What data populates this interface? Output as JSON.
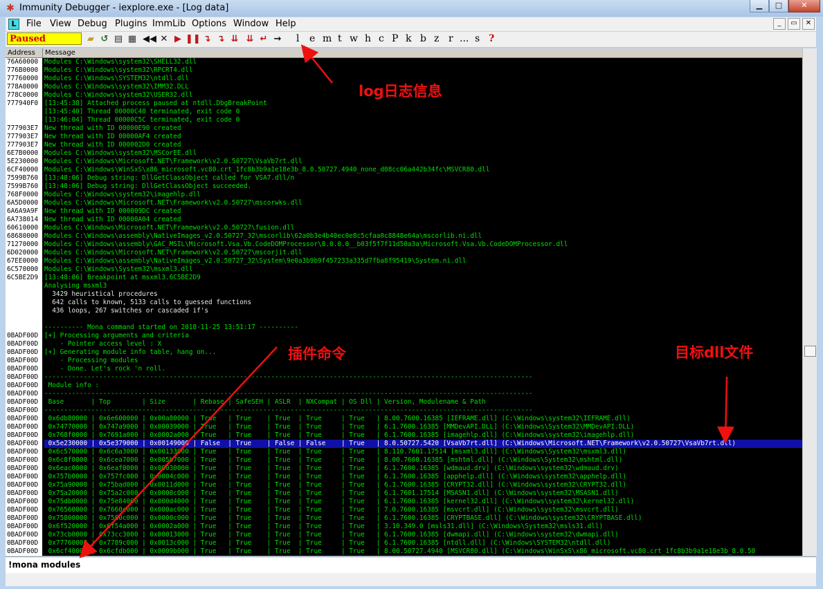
{
  "window": {
    "title": "Immunity Debugger - iexplore.exe - [Log data]",
    "min_glyph": "▁",
    "max_glyph": "□",
    "close_glyph": "✕"
  },
  "menu": {
    "doc_icon": "L",
    "items": [
      "File",
      "View",
      "Debug",
      "Plugins",
      "ImmLib",
      "Options",
      "Window",
      "Help"
    ],
    "mdi": [
      "_",
      "▭",
      "✕"
    ]
  },
  "toolbar": {
    "status": "Paused",
    "letters": [
      "l",
      "e",
      "m",
      "t",
      "w",
      "h",
      "c",
      "P",
      "k",
      "b",
      "z",
      "r",
      "...",
      "s",
      "?"
    ]
  },
  "log": {
    "header_address": "Address",
    "header_message": "Message",
    "rows": [
      [
        "76A60000",
        "Modules C:\\Windows\\system32\\SHELL32.dll",
        "g"
      ],
      [
        "776B0000",
        "Modules C:\\Windows\\system32\\RPCRT4.dll",
        "g"
      ],
      [
        "77760000",
        "Modules C:\\Windows\\SYSTEM32\\ntdll.dll",
        "g"
      ],
      [
        "778A0000",
        "Modules C:\\Windows\\system32\\IMM32.DLL",
        "g"
      ],
      [
        "778C0000",
        "Modules C:\\Windows\\system32\\USER32.dll",
        "g"
      ],
      [
        "777940F0",
        "[13:45:38] Attached process paused at ntdll.DbgBreakPoint",
        "g"
      ],
      [
        "",
        "[13:45:40] Thread 00000C40 terminated, exit code 0",
        "g"
      ],
      [
        "",
        "[13:46:04] Thread 00000C5C terminated, exit code 0",
        "g"
      ],
      [
        "777903E7",
        "New thread with ID 00000E90 created",
        "g"
      ],
      [
        "777903E7",
        "New thread with ID 00000AF4 created",
        "g"
      ],
      [
        "777903E7",
        "New thread with ID 000002D0 created",
        "g"
      ],
      [
        "6E7B0000",
        "Modules C:\\Windows\\system32\\MSCorEE.dll",
        "g"
      ],
      [
        "5E230000",
        "Modules C:\\Windows\\Microsoft.NET\\Framework\\v2.0.50727\\VsaVb7rt.dll",
        "g"
      ],
      [
        "6CF40000",
        "Modules C:\\Windows\\WinSxS\\x86_microsoft.vc80.crt_1fc8b3b9a1e18e3b_8.0.50727.4940_none_d08cc06a442b34fc\\MSVCR80.dll",
        "g"
      ],
      [
        "7599B760",
        "[13:48:06] Debug string: DllGetClassObject called for VSA7.dll/n",
        "g"
      ],
      [
        "7599B760",
        "[13:48:06] Debug string: DllGetClassObject succeeded.",
        "g"
      ],
      [
        "768F0000",
        "Modules C:\\Windows\\system32\\imagehlp.dll",
        "g"
      ],
      [
        "6A5D0000",
        "Modules C:\\Windows\\Microsoft.NET\\Framework\\v2.0.50727\\mscorwks.dll",
        "g"
      ],
      [
        "6A6A9A9F",
        "New thread with ID 000009DC created",
        "g"
      ],
      [
        "6A738014",
        "New thread with ID 00000A04 created",
        "g"
      ],
      [
        "60610000",
        "Modules C:\\Windows\\Microsoft.NET\\Framework\\v2.0.50727\\fusion.dll",
        "g"
      ],
      [
        "68680000",
        "Modules C:\\Windows\\assembly\\NativeImages_v2.0.50727_32\\mscorlib\\62a0b3e4b40ec0e8c5cfaa0c8848e64a\\mscorlib.ni.dll",
        "g"
      ],
      [
        "71270000",
        "Modules C:\\Windows\\assembly\\GAC_MSIL\\Microsoft.Vsa.Vb.CodeDOMProcessor\\8.0.0.0__b03f5f7f11d50a3a\\Microsoft.Vsa.Vb.CodeDOMProcessor.dll",
        "g"
      ],
      [
        "6D020000",
        "Modules C:\\Windows\\Microsoft.NET\\Framework\\v2.0.50727\\mscorjit.dll",
        "g"
      ],
      [
        "67EE0000",
        "Modules C:\\Windows\\assembly\\NativeImages_v2.0.50727_32\\System\\9e0a3b9b9f457233a335d7fba8f95419\\System.ni.dll",
        "g"
      ],
      [
        "6C570000",
        "Modules C:\\Windows\\System32\\msxml3.dll",
        "g"
      ],
      [
        "6C5BE2D9",
        "[13:48:06] Breakpoint at msxml3.6C5BE2D9",
        "g"
      ],
      [
        "",
        "Analysing msxml3",
        "g"
      ],
      [
        "",
        "  3429 heuristical procedures",
        "w"
      ],
      [
        "",
        "  642 calls to known, 5133 calls to guessed functions",
        "w"
      ],
      [
        "",
        "  436 loops, 267 switches or cascaded if's",
        "w"
      ],
      [
        "",
        "",
        "g"
      ],
      [
        "",
        "---------- Mona command started on 2018-11-25 13:51:17 ----------",
        "g"
      ],
      [
        "0BADF00D",
        "[+] Processing arguments and criteria",
        "g"
      ],
      [
        "0BADF00D",
        "    - Pointer access level : X",
        "g"
      ],
      [
        "0BADF00D",
        "[+] Generating module info table, hang on...",
        "g"
      ],
      [
        "0BADF00D",
        "    - Processing modules",
        "g"
      ],
      [
        "0BADF00D",
        "    - Done. Let's rock 'n roll.",
        "g"
      ],
      [
        "0BADF00D",
        "-----------------------------------------------------------------------------------------------------------------------------",
        "g"
      ],
      [
        "0BADF00D",
        " Module info :",
        "g"
      ],
      [
        "0BADF00D",
        "-----------------------------------------------------------------------------------------------------------------------------",
        "g"
      ],
      [
        "0BADF00D",
        " Base       | Top        | Size       | Rebase | SafeSEH | ASLR  | NXCompat | OS Dll | Version, Modulename & Path",
        "g"
      ],
      [
        "0BADF00D",
        "-----------------------------------------------------------------------------------------------------------------------------",
        "g"
      ],
      [
        "0BADF00D",
        " 0x6db80000 | 0x6e600000 | 0x00a80000 | True   | True    | True  | True     | True   | 8.00.7600.16385 [IEFRAME.dll] (C:\\Windows\\system32\\IEFRAME.dll)",
        "g"
      ],
      [
        "0BADF00D",
        " 0x74770000 | 0x747a9000 | 0x00039000 | True   | True    | True  | True     | True   | 6.1.7600.16385 [MMDevAPI.DLL] (C:\\Windows\\System32\\MMDevAPI.DLL)",
        "g"
      ],
      [
        "0BADF00D",
        " 0x768f0000 | 0x7691a000 | 0x0002a000 | True   | True    | True  | True     | True   | 6.1.7600.16385 [imagehlp.dll] (C:\\Windows\\system32\\imagehlp.dll)",
        "g"
      ],
      [
        "0BADF00D",
        " 0x5e230000 | 0x5e379000 | 0x00149000 | False  | True    | False | False    | True   | 8.0.50727.5420 [VsaVb7rt.dll] (C:\\Windows\\Microsoft.NET\\Framework\\v2.0.50727\\VsaVb7rt.dll)",
        "sel"
      ],
      [
        "0BADF00D",
        " 0x6c570000 | 0x6c6a3000 | 0x00133000 | True   | True    | True  | True     | True   | 8.110.7601.17514 [msxml3.dll] (C:\\Windows\\System32\\msxml3.dll)",
        "g"
      ],
      [
        "0BADF00D",
        " 0x6c8f0000 | 0x6cea7000 | 0x005b7000 | True   | True    | True  | True     | True   | 8.00.7600.16385 [mshtml.dll] (C:\\Windows\\System32\\mshtml.dll)",
        "g"
      ],
      [
        "0BADF00D",
        " 0x6eac0000 | 0x6eaf0000 | 0x00030000 | True   | True    | True  | True     | True   | 6.1.7600.16385 [wdmaud.drv] (C:\\Windows\\system32\\wdmaud.drv)",
        "g"
      ],
      [
        "0BADF00D",
        " 0x757b0000 | 0x757fc000 | 0x0004c000 | True   | True    | True  | True     | True   | 6.1.7600.16385 [apphelp.dll] (C:\\Windows\\system32\\apphelp.dll)",
        "g"
      ],
      [
        "0BADF00D",
        " 0x75a90000 | 0x75bad000 | 0x0011d000 | True   | True    | True  | True     | True   | 6.1.7600.16385 [CRYPT32.dll] (C:\\Windows\\system32\\CRYPT32.dll)",
        "g"
      ],
      [
        "0BADF00D",
        " 0x75a20000 | 0x75a2c000 | 0x0000c000 | True   | True    | True  | True     | True   | 6.1.7601.17514 [MSASN1.dll] (C:\\Windows\\system32\\MSASN1.dll)",
        "g"
      ],
      [
        "0BADF00D",
        " 0x75db0000 | 0x75e84000 | 0x000d4000 | True   | True    | True  | True     | True   | 6.1.7600.16385 [kernel32.dll] (C:\\Windows\\system32\\kernel32.dll)",
        "g"
      ],
      [
        "0BADF00D",
        " 0x76560000 | 0x7660c000 | 0x000ac000 | True   | True    | True  | True     | True   | 7.0.7600.16385 [msvcrt.dll] (C:\\Windows\\system32\\msvcrt.dll)",
        "g"
      ],
      [
        "0BADF00D",
        " 0x75800000 | 0x7580c000 | 0x0000c000 | True   | True    | True  | True     | True   | 6.1.7600.16385 [CRYPTBASE.dll] (C:\\Windows\\system32\\CRYPTBASE.dll)",
        "g"
      ],
      [
        "0BADF00D",
        " 0x6f520000 | 0x6f54a000 | 0x0002a000 | True   | True    | True  | True     | True   | 3.10.349.0 [msls31.dll] (C:\\Windows\\System32\\msls31.dll)",
        "g"
      ],
      [
        "0BADF00D",
        " 0x73cb0000 | 0x73cc3000 | 0x00013000 | True   | True    | True  | True     | True   | 6.1.7600.16385 [dwmapi.dll] (C:\\Windows\\system32\\dwmapi.dll)",
        "g"
      ],
      [
        "0BADF00D",
        " 0x77760000 | 0x7789c000 | 0x0013c000 | True   | True    | True  | True     | True   | 6.1.7600.16385 [ntdll.dll] (C:\\Windows\\SYSTEM32\\ntdll.dll)",
        "g"
      ],
      [
        "0BADF00D",
        " 0x6cf40000 | 0x6cfdb000 | 0x0009b000 | True   | True    | True  | True     | True   | 8.00.50727.4940 [MSVCR80.dll] (C:\\Windows\\WinSxS\\x86_microsoft.vc80.crt_1fc8b3b9a1e18e3b_8.0.50",
        "g"
      ]
    ]
  },
  "command": {
    "value": "!mona modules"
  },
  "annotations": {
    "log": "log日志信息",
    "plugin": "插件命令",
    "target": "目标dll文件"
  },
  "colors": {
    "log_bg": "#000000",
    "log_text": "#00e000",
    "selection": "#1010a8",
    "annotation": "#f01010",
    "paused_bg": "#ffff00",
    "paused_text": "#d40000"
  }
}
